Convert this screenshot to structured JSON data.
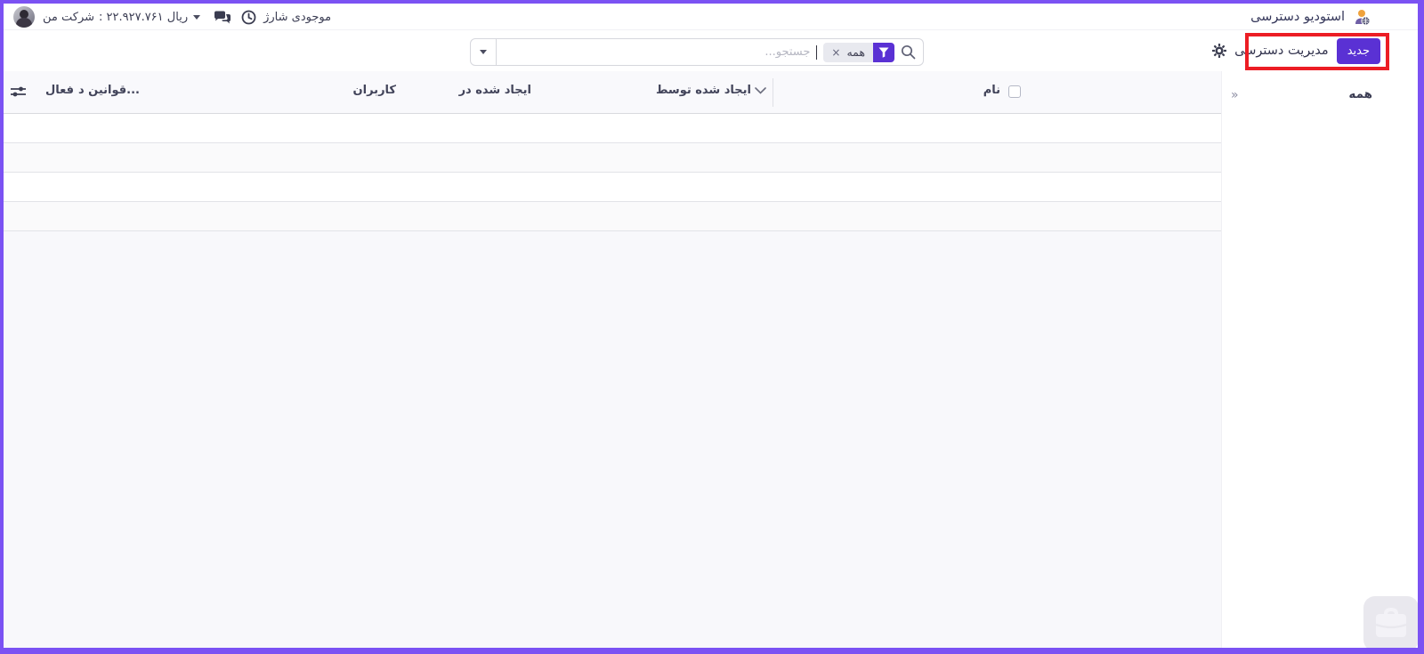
{
  "topbar": {
    "app_title": "استودیو دسترسی",
    "company": "شرکت من",
    "balance_label": "موجودی شارژ",
    "balance_value": ": ۲۲.۹۲۷.۷۶۱ ریال"
  },
  "control": {
    "new_button": "جدید",
    "breadcrumb": "مدیریت دسترسی",
    "search": {
      "placeholder": "جستجو...",
      "facet_label": "همه",
      "facet_remove": "×"
    }
  },
  "table": {
    "headers": {
      "name": "نام",
      "created_by": "ایجاد شده توسط",
      "created_on": "ایجاد شده در",
      "users": "کاربران",
      "rules": "قوانین د...",
      "active": "فعال"
    },
    "empty_row_count": 4
  },
  "sidebar": {
    "all_label": "همه",
    "collapse_glyph": "»"
  },
  "colors": {
    "accent_purple": "#5a31d4",
    "frame_purple": "#7b52f3",
    "annotation_red": "#ec1d24"
  }
}
